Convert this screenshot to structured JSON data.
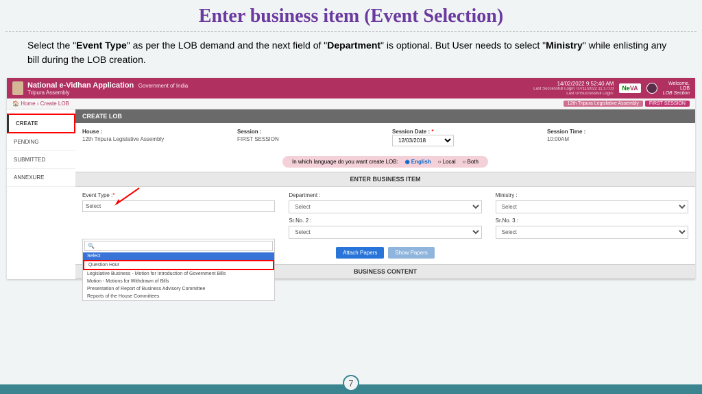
{
  "slide": {
    "title": "Enter business item (Event Selection)",
    "instruction_pre": "Select the \"",
    "instruction_b1": "Event Type",
    "instruction_mid1": "\" as per the LOB demand and the next field of  \"",
    "instruction_b2": "Department",
    "instruction_mid2": "\"  is optional. But User needs to select \"",
    "instruction_b3": "Ministry",
    "instruction_post": "\" while enlisting any bill during the LOB creation.",
    "page_number": "7"
  },
  "app": {
    "title": "National e-Vidhan Application",
    "subtitle": "Government of India",
    "assembly": "Tripura Assembly",
    "datetime": "14/02/2022 9:52:40 AM",
    "last_success": "Last Successfull Login: 07/11/2022 11:17:03",
    "last_unsuccess": "Last UnSuccessfull Login:",
    "neva_n": "N",
    "neva_e": "e",
    "neva_va": "VA",
    "welcome": "Welcome,",
    "welcome_user": "LOB",
    "welcome_section": "LOB Section"
  },
  "breadcrumb": {
    "home": "Home",
    "current": "Create LOB",
    "badge1": "12th Tripura Legislative Assembly",
    "badge2": "FIRST SESSION"
  },
  "sidebar": {
    "items": [
      "CREATE",
      "PENDING",
      "SUBMITTED",
      "ANNEXURE"
    ]
  },
  "lob": {
    "header": "CREATE LOB",
    "house_label": "House :",
    "house_value": "12th Tripura Legislative Assembly",
    "session_label": "Session :",
    "session_value": "FIRST SESSION",
    "session_date_label": "Session Date :",
    "session_date_value": "12/03/2018",
    "session_time_label": "Session Time :",
    "session_time_value": "10:00AM",
    "lang_prompt": "In which language do you want create LOB:",
    "lang_en": "English",
    "lang_local": "Local",
    "lang_both": "Both"
  },
  "business": {
    "header": "ENTER BUSINESS ITEM",
    "event_type_label": "Event Type :",
    "dept_label": "Department :",
    "ministry_label": "Ministry :",
    "srno2_label": "Sr.No. 2 :",
    "srno3_label": "Sr.No. 3 :",
    "select_placeholder": "Select",
    "search_icon": "🔍",
    "dd_select": "Select",
    "dd_qh": "Question Hour",
    "dd_leg": "Legislative Business - Motion for Introduction of Government Bills",
    "dd_motion": "Motion - Motions for Withdrawn of Bills",
    "dd_report": "Presentation of Report of Business Advisory Committee",
    "dd_house": "Reports of the House Committees",
    "attach_btn": "Attach Papers",
    "show_btn": "Show Papers",
    "content_header": "BUSINESS CONTENT"
  }
}
